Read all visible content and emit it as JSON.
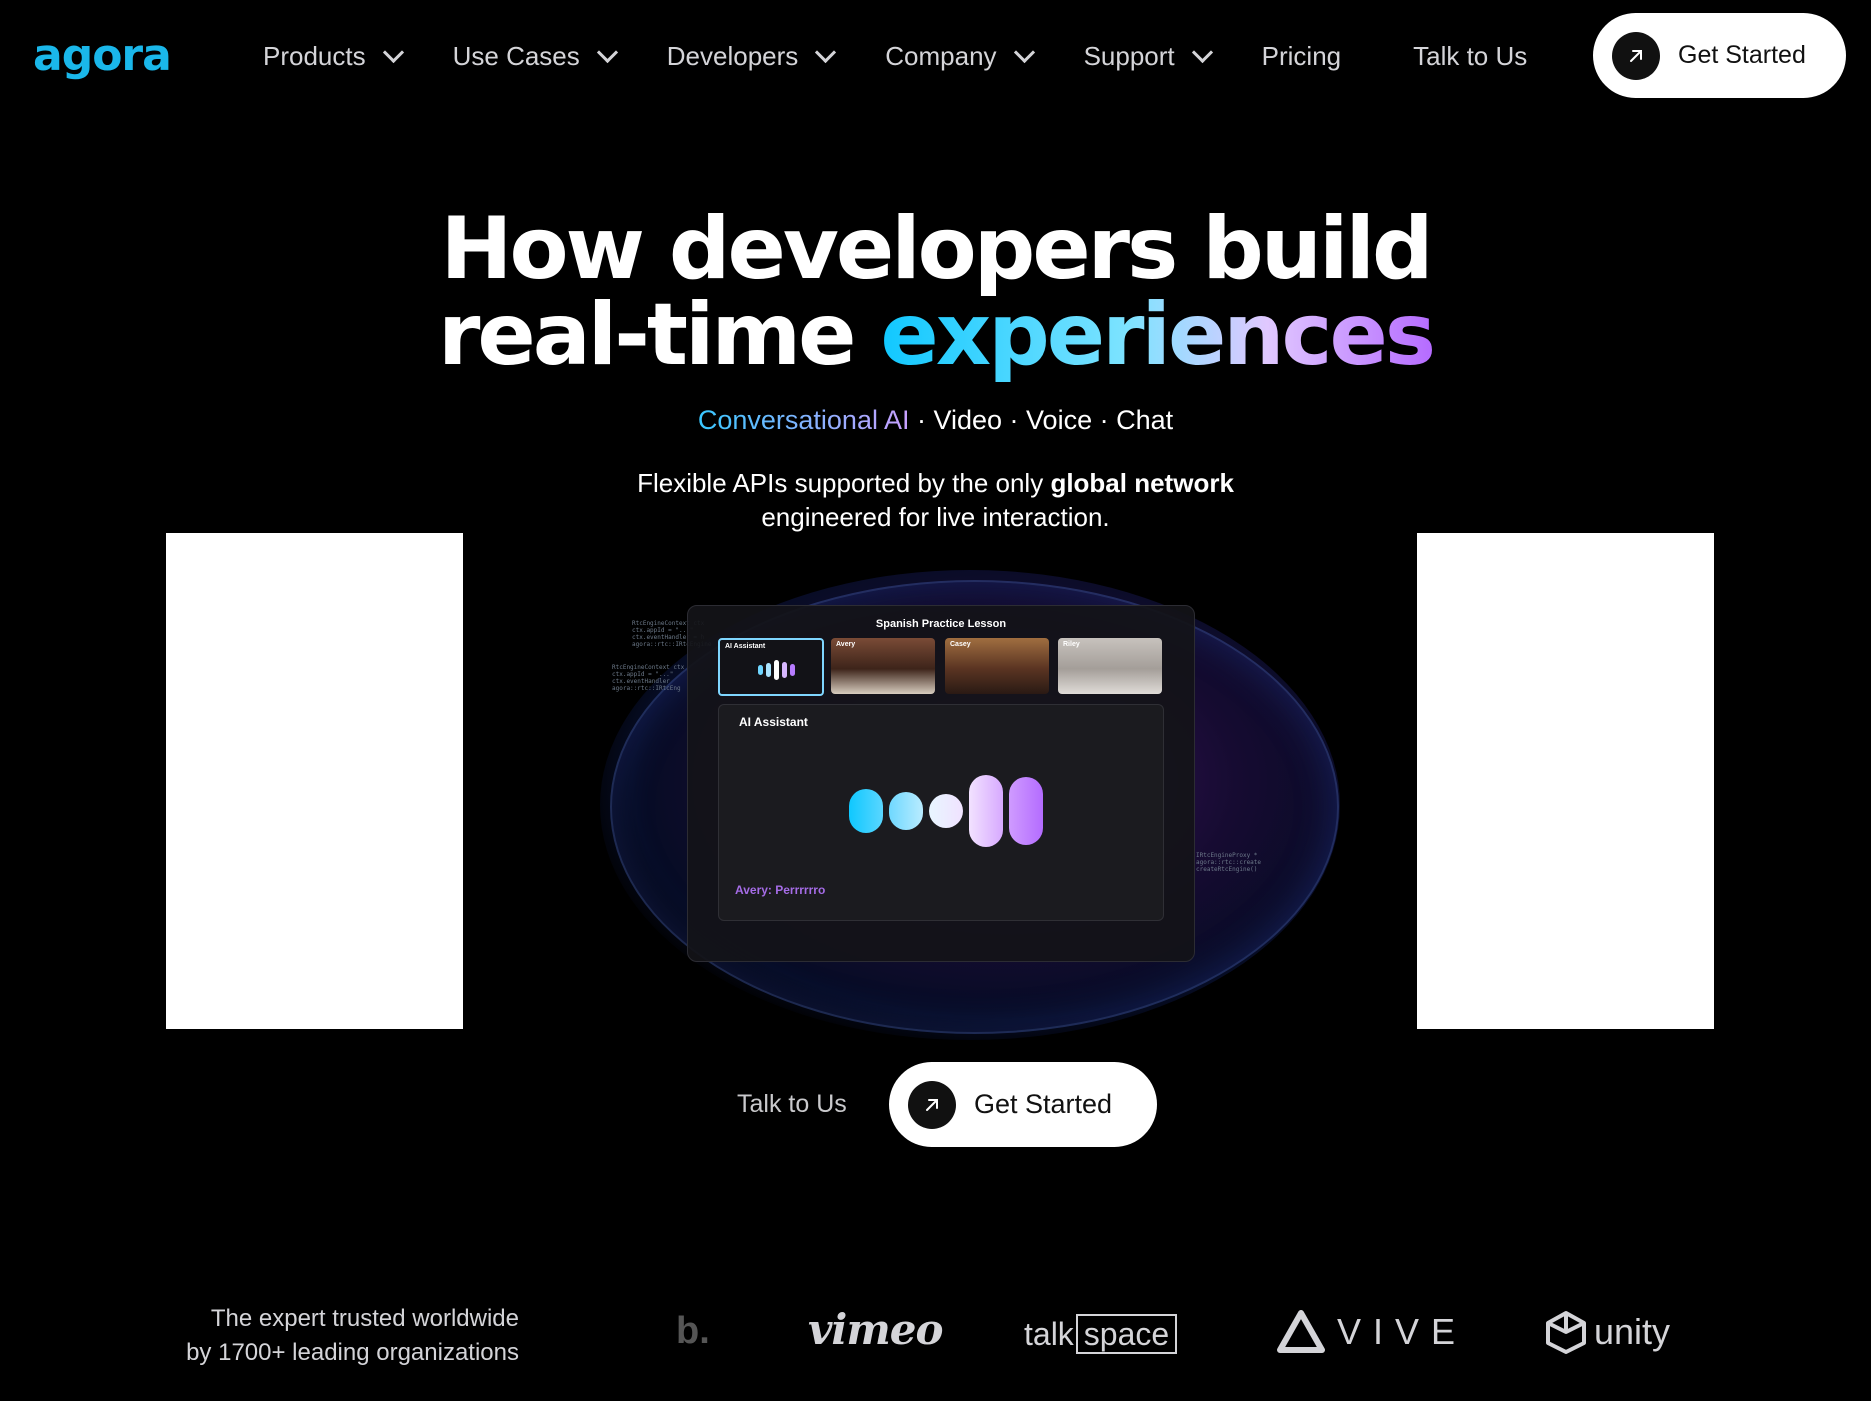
{
  "brand": {
    "logo_text": "agora",
    "accent": "#1ab7ea"
  },
  "nav": {
    "items": [
      {
        "label": "Products",
        "has_dropdown": true
      },
      {
        "label": "Use Cases",
        "has_dropdown": true
      },
      {
        "label": "Developers",
        "has_dropdown": true
      },
      {
        "label": "Company",
        "has_dropdown": true
      },
      {
        "label": "Support",
        "has_dropdown": true
      },
      {
        "label": "Pricing",
        "has_dropdown": false
      },
      {
        "label": "Talk to Us",
        "has_dropdown": false
      }
    ],
    "cta_label": "Get Started"
  },
  "hero": {
    "title_line1": "How developers build",
    "title_line2_plain": "real-time ",
    "title_line2_highlight": "experiences",
    "sub_highlight": "Conversational AI",
    "sub_rest": " · Video · Voice · Chat",
    "desc_part1": "Flexible APIs supported by the only ",
    "desc_bold": "global network",
    "desc_part2": "engineered for live interaction."
  },
  "demo": {
    "window_title": "Spanish Practice Lesson",
    "participants": [
      "AI Assistant",
      "Avery",
      "Casey",
      "Riley"
    ],
    "main_label": "AI Assistant",
    "caption": "Avery: Perrrrrro"
  },
  "cta": {
    "talk_label": "Talk to Us",
    "start_label": "Get Started"
  },
  "trust": {
    "line1": "The expert trusted worldwide",
    "line2": "by 1700+ leading organizations",
    "logos": {
      "partial": "b.",
      "vimeo": "vimeo",
      "talk": "talk",
      "space": "space",
      "vive": "VIVE",
      "unity": "unity"
    }
  }
}
